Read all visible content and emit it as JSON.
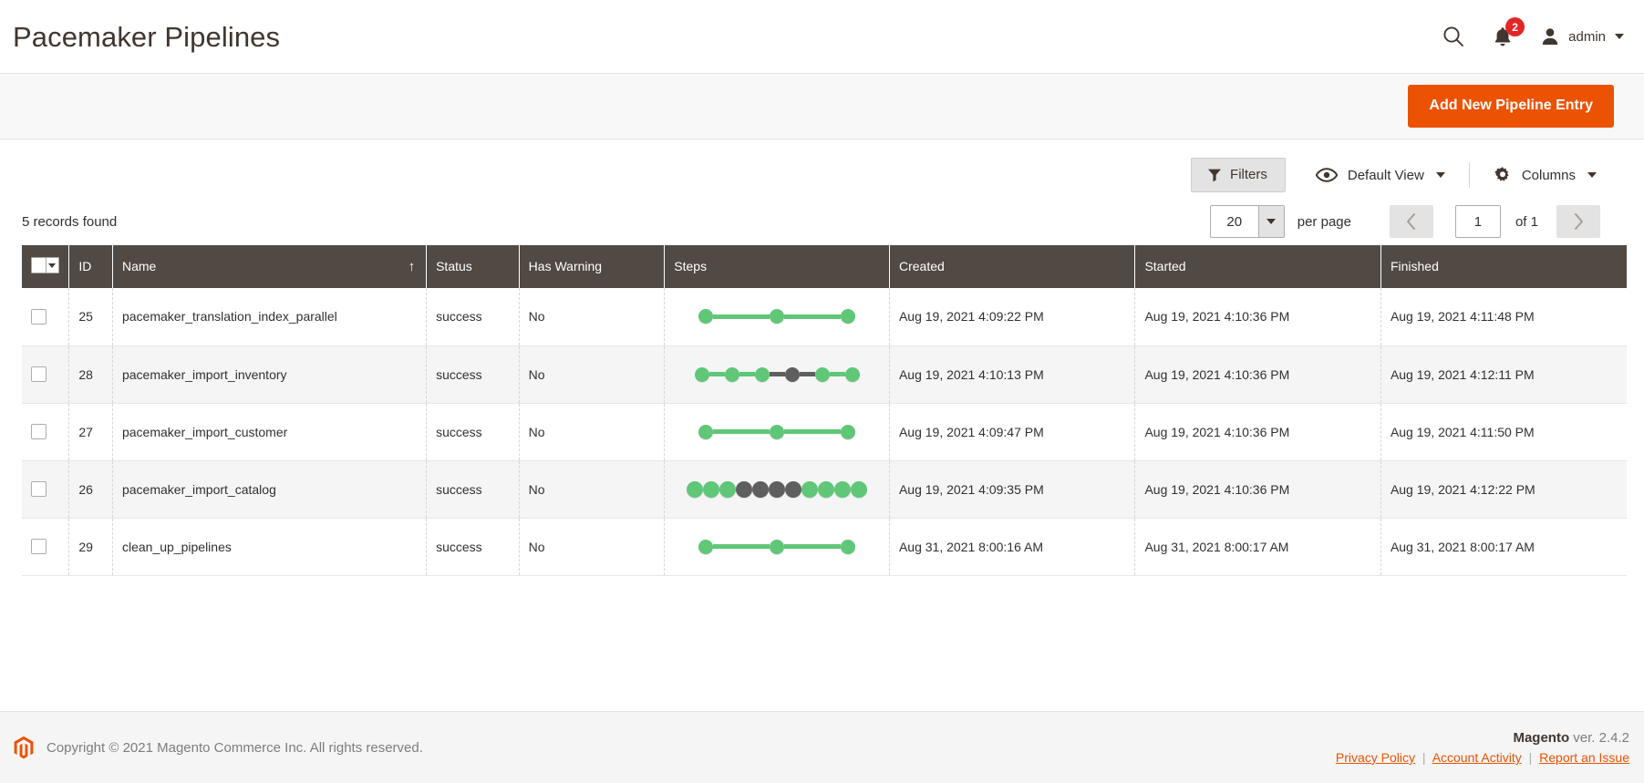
{
  "header": {
    "title": "Pacemaker Pipelines",
    "search_icon": "search-icon",
    "notifications_icon": "bell-icon",
    "notifications_count": "2",
    "user_icon": "user-avatar-icon",
    "user_name": "admin"
  },
  "page_actions": {
    "add_new_label": "Add New Pipeline Entry",
    "primary_color": "#eb5202"
  },
  "toolbar": {
    "filters_label": "Filters",
    "filters_icon": "funnel-icon",
    "view_label": "Default View",
    "view_icon": "eye-icon",
    "columns_label": "Columns",
    "columns_icon": "gear-icon"
  },
  "grid_meta": {
    "records_found": "5 records found",
    "per_page_value": "20",
    "per_page_label": "per page",
    "current_page": "1",
    "of_pages": "of 1",
    "prev_icon": "chevron-left-icon",
    "next_icon": "chevron-right-icon"
  },
  "table": {
    "columns": [
      {
        "key": "checkbox",
        "label": ""
      },
      {
        "key": "id",
        "label": "ID"
      },
      {
        "key": "name",
        "label": "Name",
        "sort": "↑"
      },
      {
        "key": "status",
        "label": "Status"
      },
      {
        "key": "has_warning",
        "label": "Has Warning"
      },
      {
        "key": "steps",
        "label": "Steps"
      },
      {
        "key": "created",
        "label": "Created"
      },
      {
        "key": "started",
        "label": "Started"
      },
      {
        "key": "finished",
        "label": "Finished"
      }
    ],
    "step_colors": {
      "success": "#5fc777",
      "pending": "#5f5f5f"
    },
    "rows": [
      {
        "id": "25",
        "name": "pacemaker_translation_index_parallel",
        "status": "success",
        "has_warning": "No",
        "steps": [
          "success",
          "success",
          "success"
        ],
        "steps_style": "spread",
        "created": "Aug 19, 2021 4:09:22 PM",
        "started": "Aug 19, 2021 4:10:36 PM",
        "finished": "Aug 19, 2021 4:11:48 PM"
      },
      {
        "id": "28",
        "name": "pacemaker_import_inventory",
        "status": "success",
        "has_warning": "No",
        "steps": [
          "success",
          "success",
          "success",
          "pending",
          "success",
          "success"
        ],
        "steps_style": "medium",
        "created": "Aug 19, 2021 4:10:13 PM",
        "started": "Aug 19, 2021 4:10:36 PM",
        "finished": "Aug 19, 2021 4:12:11 PM"
      },
      {
        "id": "27",
        "name": "pacemaker_import_customer",
        "status": "success",
        "has_warning": "No",
        "steps": [
          "success",
          "success",
          "success"
        ],
        "steps_style": "spread",
        "created": "Aug 19, 2021 4:09:47 PM",
        "started": "Aug 19, 2021 4:10:36 PM",
        "finished": "Aug 19, 2021 4:11:50 PM"
      },
      {
        "id": "26",
        "name": "pacemaker_import_catalog",
        "status": "success",
        "has_warning": "No",
        "steps": [
          "success",
          "success",
          "success",
          "pending",
          "pending",
          "pending",
          "pending",
          "success",
          "success",
          "success",
          "success"
        ],
        "steps_style": "dense",
        "created": "Aug 19, 2021 4:09:35 PM",
        "started": "Aug 19, 2021 4:10:36 PM",
        "finished": "Aug 19, 2021 4:12:22 PM"
      },
      {
        "id": "29",
        "name": "clean_up_pipelines",
        "status": "success",
        "has_warning": "No",
        "steps": [
          "success",
          "success",
          "success"
        ],
        "steps_style": "spread",
        "created": "Aug 31, 2021 8:00:16 AM",
        "started": "Aug 31, 2021 8:00:17 AM",
        "finished": "Aug 31, 2021 8:00:17 AM"
      }
    ]
  },
  "footer": {
    "copyright": "Copyright © 2021 Magento Commerce Inc. All rights reserved.",
    "logo_icon": "magento-logo-icon",
    "version_brand": "Magento",
    "version_text": " ver. 2.4.2",
    "links": [
      {
        "label": "Privacy Policy"
      },
      {
        "label": "Account Activity"
      },
      {
        "label": "Report an Issue"
      }
    ],
    "link_separator": "|"
  }
}
